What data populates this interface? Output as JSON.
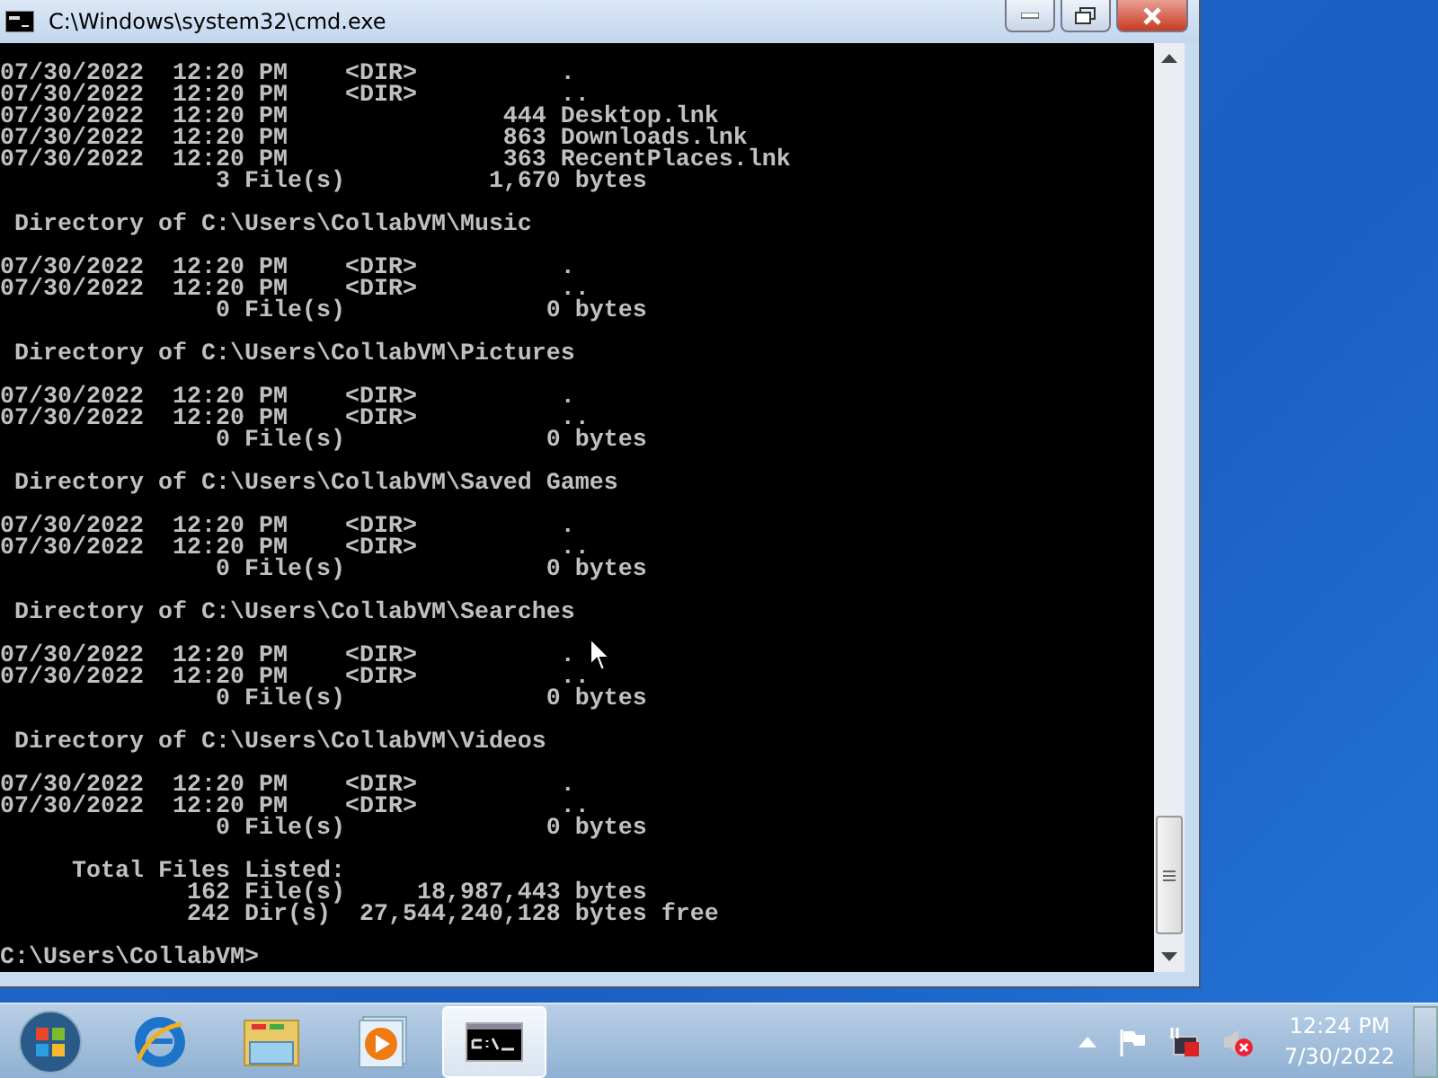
{
  "window": {
    "title": "C:\\Windows\\system32\\cmd.exe"
  },
  "console": {
    "blocks": [
      [
        "07/30/2022  12:20 PM    <DIR>          .",
        "07/30/2022  12:20 PM    <DIR>          ..",
        "07/30/2022  12:20 PM               444 Desktop.lnk",
        "07/30/2022  12:20 PM               863 Downloads.lnk",
        "07/30/2022  12:20 PM               363 RecentPlaces.lnk",
        "               3 File(s)          1,670 bytes"
      ],
      [
        " Directory of C:\\Users\\CollabVM\\Music"
      ],
      [
        "07/30/2022  12:20 PM    <DIR>          .",
        "07/30/2022  12:20 PM    <DIR>          ..",
        "               0 File(s)              0 bytes"
      ],
      [
        " Directory of C:\\Users\\CollabVM\\Pictures"
      ],
      [
        "07/30/2022  12:20 PM    <DIR>          .",
        "07/30/2022  12:20 PM    <DIR>          ..",
        "               0 File(s)              0 bytes"
      ],
      [
        " Directory of C:\\Users\\CollabVM\\Saved Games"
      ],
      [
        "07/30/2022  12:20 PM    <DIR>          .",
        "07/30/2022  12:20 PM    <DIR>          ..",
        "               0 File(s)              0 bytes"
      ],
      [
        " Directory of C:\\Users\\CollabVM\\Searches"
      ],
      [
        "07/30/2022  12:20 PM    <DIR>          .",
        "07/30/2022  12:20 PM    <DIR>          ..",
        "               0 File(s)              0 bytes"
      ],
      [
        " Directory of C:\\Users\\CollabVM\\Videos"
      ],
      [
        "07/30/2022  12:20 PM    <DIR>          .",
        "07/30/2022  12:20 PM    <DIR>          ..",
        "               0 File(s)              0 bytes"
      ],
      [
        "     Total Files Listed:",
        "             162 File(s)     18,987,443 bytes",
        "             242 Dir(s)  27,544,240,128 bytes free"
      ],
      [
        "C:\\Users\\CollabVM>"
      ]
    ]
  },
  "taskbar": {
    "pinned": [
      {
        "kind": "browser",
        "selected": false
      },
      {
        "kind": "folder",
        "selected": false
      },
      {
        "kind": "media",
        "selected": false
      },
      {
        "kind": "console",
        "selected": true
      }
    ],
    "clock": {
      "time": "12:24 PM",
      "date": "7/30/2022"
    }
  }
}
